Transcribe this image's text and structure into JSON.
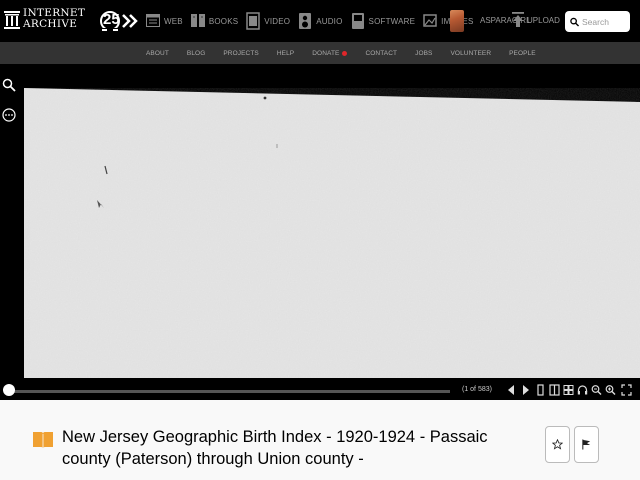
{
  "header": {
    "logo_line1": "INTERNET",
    "logo_line2": "ARCHIVE",
    "anniversary_mark": "25",
    "media": [
      {
        "label": "WEB",
        "icon": "web-icon"
      },
      {
        "label": "BOOKS",
        "icon": "books-icon"
      },
      {
        "label": "VIDEO",
        "icon": "video-icon"
      },
      {
        "label": "AUDIO",
        "icon": "audio-icon"
      },
      {
        "label": "SOFTWARE",
        "icon": "software-icon"
      },
      {
        "label": "IMAGES",
        "icon": "images-icon"
      }
    ],
    "user": "ASPARAGIRL",
    "upload_label": "UPLOAD",
    "search_placeholder": "Search"
  },
  "subnav": [
    "ABOUT",
    "BLOG",
    "PROJECTS",
    "HELP",
    "DONATE",
    "CONTACT",
    "JOBS",
    "VOLUNTEER",
    "PEOPLE"
  ],
  "reader": {
    "page_indicator": "(1 of 583)",
    "current_page": 1,
    "total_pages": 583,
    "side_tools": [
      "search-icon",
      "more-options-icon"
    ],
    "controls": [
      "previous-page-icon",
      "next-page-icon",
      "one-page-view-icon",
      "two-page-view-icon",
      "thumbnail-view-icon",
      "read-aloud-icon",
      "zoom-out-icon",
      "zoom-in-icon",
      "fullscreen-icon"
    ]
  },
  "item": {
    "title": "New Jersey Geographic Birth Index - 1920-1924 - Passaic county (Paterson) through Union county -",
    "actions": [
      "favorite-star-icon",
      "flag-icon"
    ]
  },
  "colors": {
    "topbar": "#000000",
    "subnav": "#333333",
    "donate_heart": "#e0262a",
    "page": "#e6e6e6",
    "title_bg": "#f9f9f9",
    "book_icon": "#f0a132"
  }
}
